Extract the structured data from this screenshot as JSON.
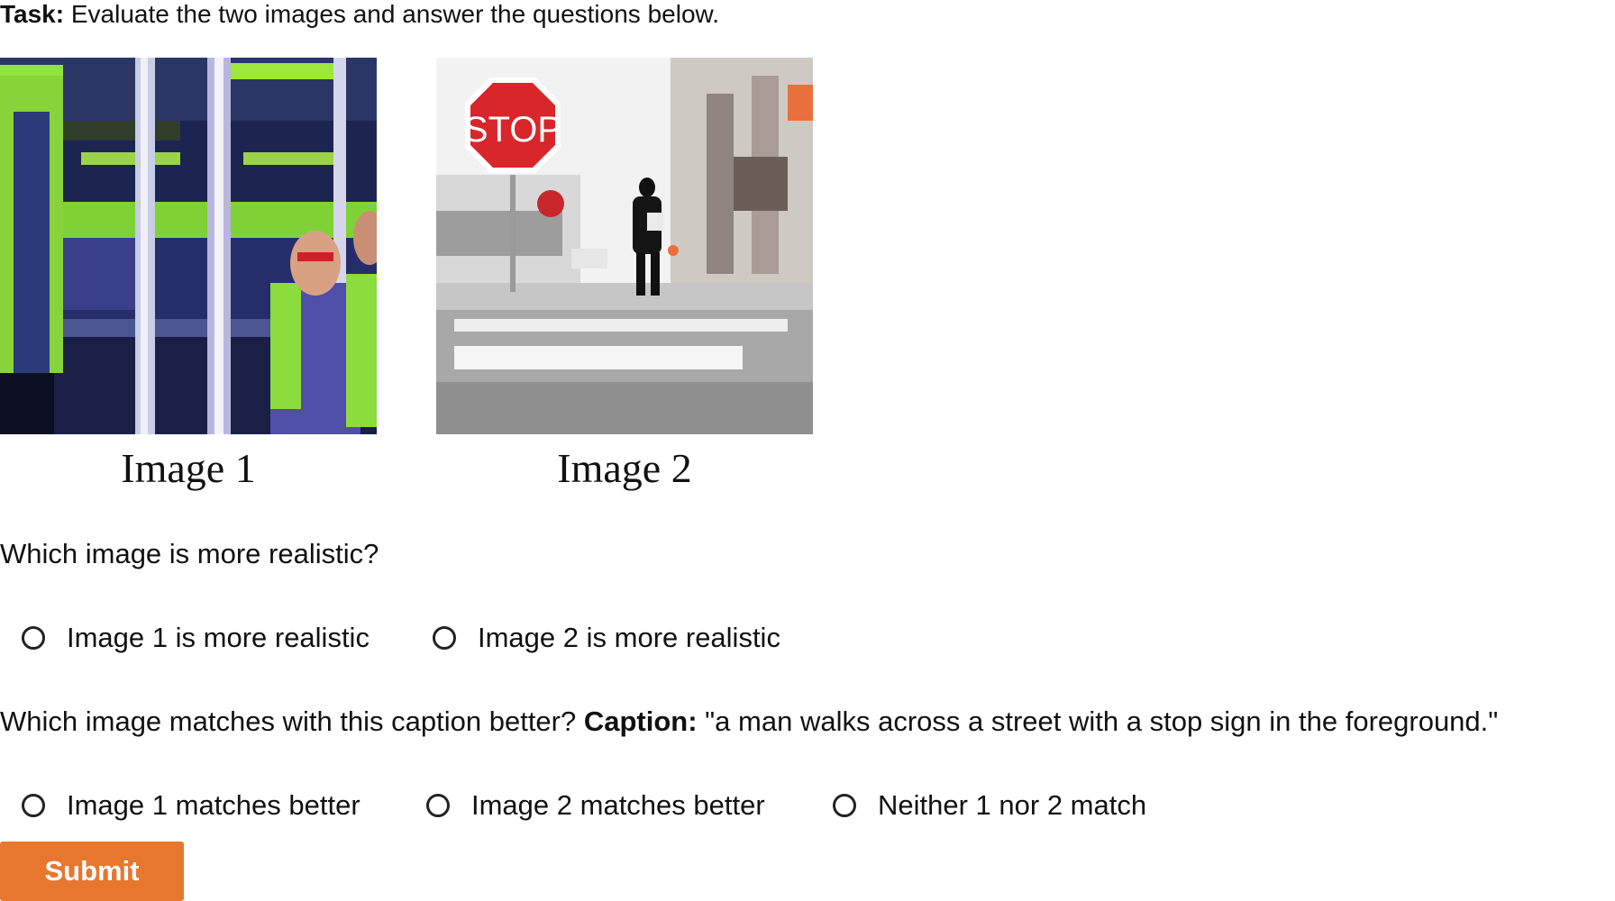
{
  "task": {
    "label": "Task:",
    "text": " Evaluate the two images and answer the questions below."
  },
  "images": [
    {
      "caption": "Image 1"
    },
    {
      "caption": "Image 2",
      "sign_text": "STOP"
    }
  ],
  "question1": {
    "text": "Which image is more realistic?",
    "options": [
      "Image 1 is more realistic",
      "Image 2 is more realistic"
    ]
  },
  "question2": {
    "text": "Which image matches with this caption better? ",
    "caption_label": "Caption:",
    "caption_text": " \"a man walks across a street with a stop sign in the foreground.\"",
    "options": [
      "Image 1 matches better",
      "Image 2 matches better",
      "Neither 1 nor 2 match"
    ]
  },
  "submit": {
    "label": "Submit"
  },
  "colors": {
    "submit_bg": "#e8772e",
    "radio_border": "#222222",
    "stop_sign": "#d8262a"
  }
}
